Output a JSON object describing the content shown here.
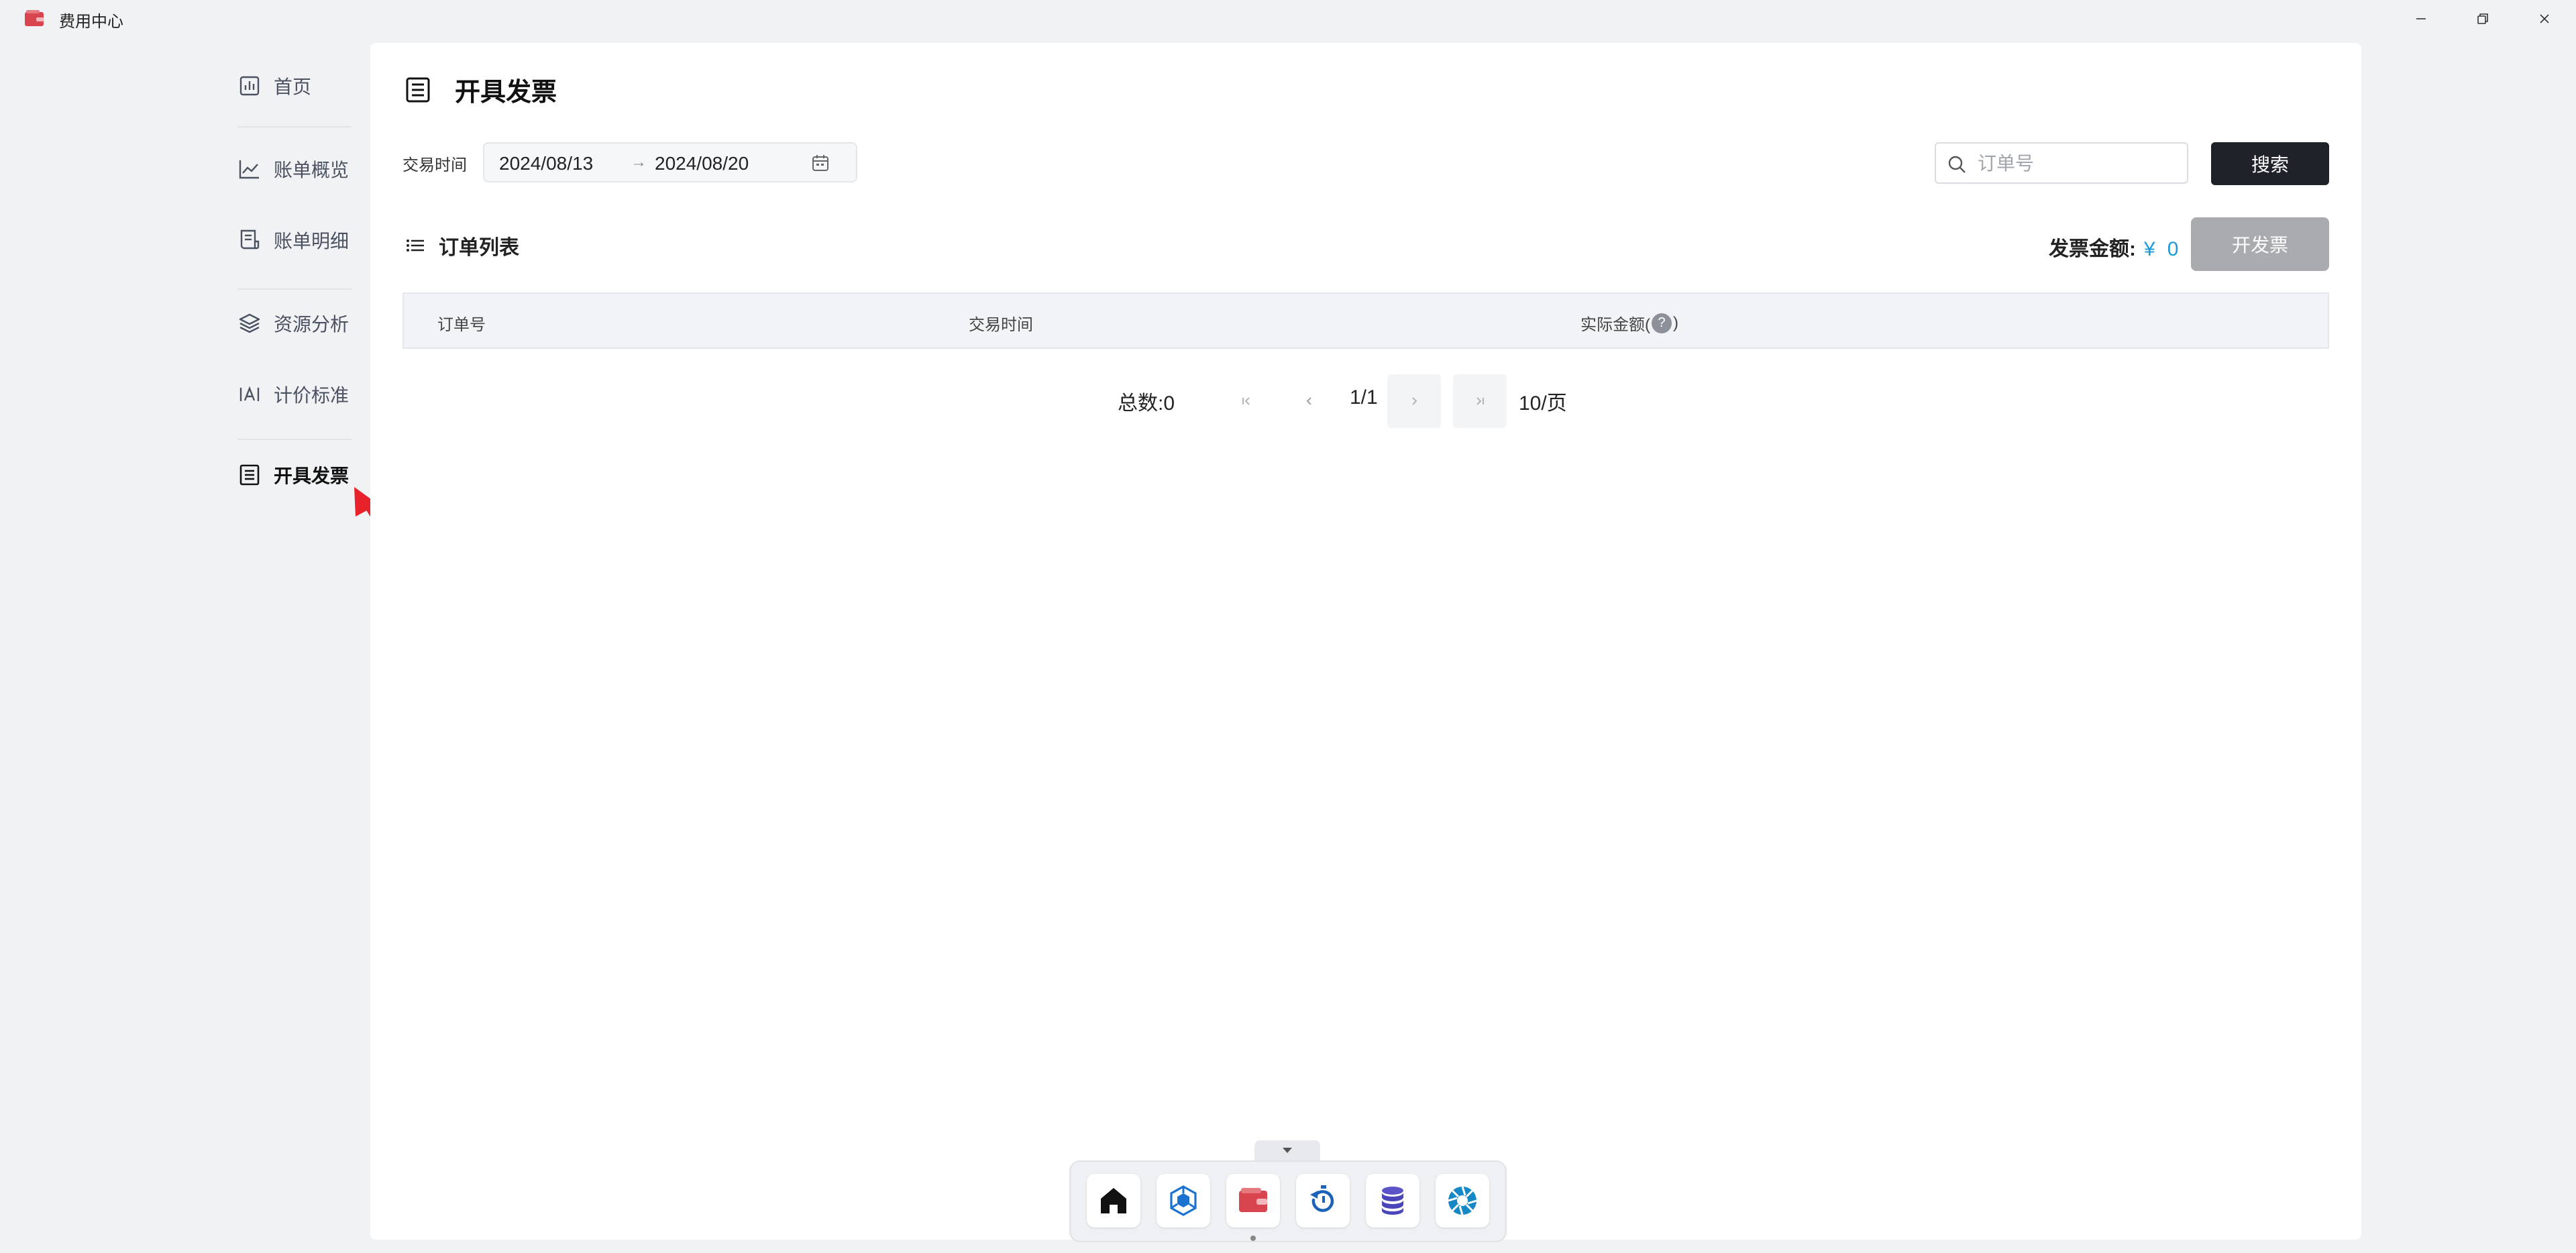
{
  "window": {
    "title": "费用中心"
  },
  "sidebar": {
    "items": [
      {
        "label": "首页",
        "icon": "bar-chart-icon"
      },
      {
        "label": "账单概览",
        "icon": "line-chart-icon"
      },
      {
        "label": "账单明细",
        "icon": "receipt-icon"
      },
      {
        "label": "资源分析",
        "icon": "layers-icon"
      },
      {
        "label": "计价标准",
        "icon": "text-box-icon"
      },
      {
        "label": "开具发票",
        "icon": "document-icon",
        "active": true
      }
    ]
  },
  "main": {
    "title": "开具发票",
    "filter": {
      "label": "交易时间",
      "start_date": "2024/08/13",
      "separator": "→",
      "end_date": "2024/08/20"
    },
    "search": {
      "placeholder": "订单号",
      "value": "",
      "button_label": "搜索"
    },
    "list": {
      "title": "订单列表",
      "invoice_amount_label": "发票金额:",
      "currency": "¥",
      "invoice_amount_value": "0",
      "invoice_button_label": "开发票"
    },
    "table": {
      "columns": [
        "订单号",
        "交易时间",
        "实际金额("
      ],
      "column_suffix": ")",
      "help_glyph": "?",
      "rows": []
    },
    "pagination": {
      "total_label": "总数:0",
      "page_indicator": "1/1",
      "page_size": "10/页"
    }
  },
  "dock": {
    "toggle_icon": "chevron-down-icon",
    "items": [
      {
        "icon": "home-icon"
      },
      {
        "icon": "cube-network-icon"
      },
      {
        "icon": "wallet-icon",
        "active": true
      },
      {
        "icon": "stopwatch-refresh-icon"
      },
      {
        "icon": "database-icon"
      },
      {
        "icon": "aperture-icon"
      }
    ]
  },
  "colors": {
    "accent": "#1a9ad6",
    "dark_button": "#1f2329",
    "disabled_button": "#a9abae",
    "annotation_arrow": "#e8222a",
    "app_icon": "#d9454e"
  }
}
